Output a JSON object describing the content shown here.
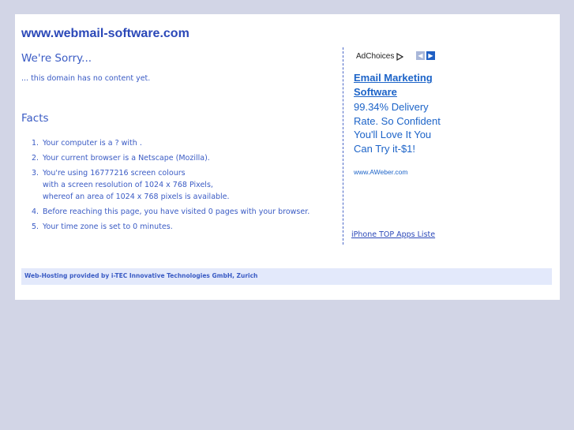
{
  "header": {
    "site_title": "www.webmail-software.com"
  },
  "main": {
    "sorry_heading": "We're Sorry...",
    "no_content_text": "... this domain has no content yet.",
    "facts_heading": "Facts",
    "facts": [
      {
        "num": "1.",
        "lines": [
          "Your computer is a ? with ."
        ]
      },
      {
        "num": "2.",
        "lines": [
          "Your current browser is a Netscape (Mozilla)."
        ]
      },
      {
        "num": "3.",
        "lines": [
          "You're using 16777216 screen colours",
          "with a screen resolution of 1024 x 768 Pixels,",
          "whereof an area of 1024 x 768 pixels is available."
        ]
      },
      {
        "num": "4.",
        "lines": [
          "Before reaching this page, you have visited 0 pages with your browser."
        ]
      },
      {
        "num": "5.",
        "lines": [
          "Your time zone is set to 0 minutes."
        ]
      }
    ]
  },
  "ad": {
    "adchoices_label": "AdChoices",
    "prev_arrow": "◀",
    "next_arrow": "▶",
    "title": "Email Marketing Software",
    "body": "99.34% Delivery Rate. So Confident You'll Love It You Can Try it-$1!",
    "url": "www.AWeber.com"
  },
  "sidebar": {
    "link_label": "iPhone TOP Apps Liste"
  },
  "footer": {
    "text": "Web-Hosting provided by i-TEC Innovative Technologies GmbH, Zurich"
  }
}
